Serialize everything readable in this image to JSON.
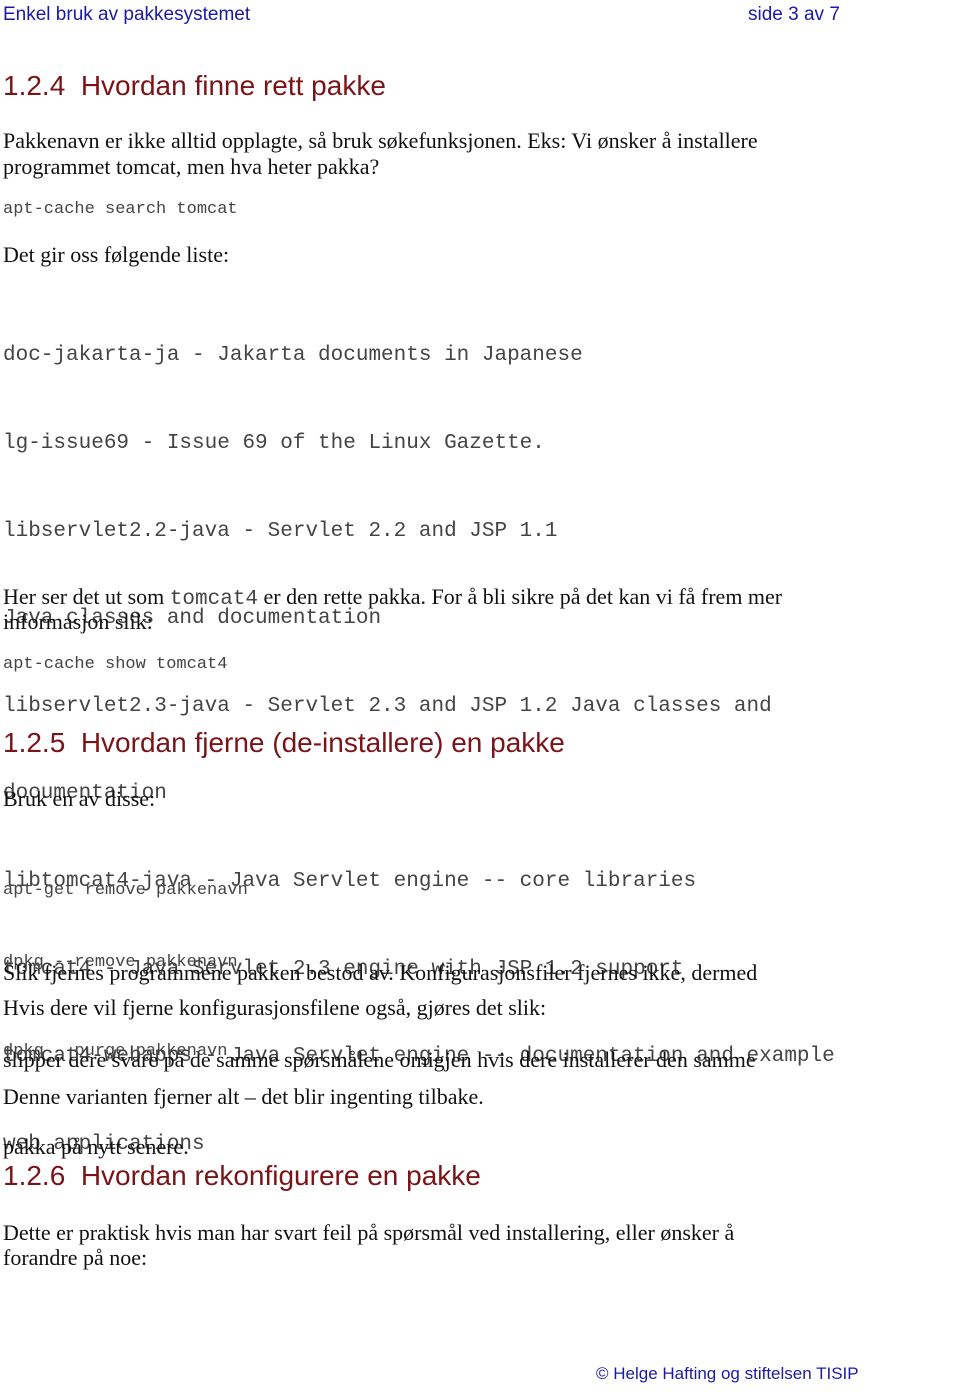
{
  "header": {
    "doc_title": "Enkel bruk av pakkesystemet",
    "page_indicator": "side 3 av 7"
  },
  "sections": [
    {
      "heading": "1.2.4  Hvordan finne rett pakke",
      "intro_line1": "Pakkenavn er ikke alltid opplagte, så bruk søkefunksjonen. Eks: Vi ønsker å installere",
      "intro_line2": "programmet tomcat, men hva heter pakka?",
      "command": "apt-cache search tomcat",
      "list_intro": "Det gir oss følgende liste:",
      "output_lines": [
        "doc-jakarta-ja - Jakarta documents in Japanese",
        "lg-issue69 - Issue 69 of the Linux Gazette.",
        "libservlet2.2-java - Servlet 2.2 and JSP 1.1",
        "Java classes and documentation",
        "libservlet2.3-java - Servlet 2.3 and JSP 1.2 Java classes and",
        "documentation",
        "libtomcat4-java - Java Servlet engine -- core libraries",
        "tomcat4 - Java Servlet 2.3 engine with JSP 1.2 support",
        "tomcat4-webapps - Java Servlet engine -- documentation and example",
        "web applications"
      ],
      "conclusion_pre": "Her ser det ut som ",
      "conclusion_code": "tomcat4",
      "conclusion_post": " er den rette pakka. For å bli sikre på det kan vi få frem mer",
      "conclusion_line2": "informasjon slik:",
      "command2": "apt-cache show tomcat4"
    },
    {
      "heading": "1.2.5  Hvordan fjerne (de-installere) en pakke",
      "intro": "Bruk en av disse:",
      "commands": [
        "apt-get remove pakkenavn",
        "dpkg --remove pakkenavn"
      ],
      "para_lines": [
        "Slik fjernes programmene pakken bestod av. Konfigurasjonsfiler fjernes ikke, dermed",
        "slipper dere svare på de samme spørsmålene omigjen hvis dere installerer den samme",
        "pakka på nytt senere."
      ],
      "purge_intro": "Hvis dere vil fjerne konfigurasjonsfilene også, gjøres det slik:",
      "purge_command": "dpkg --purge pakkenavn",
      "purge_note": "Denne varianten fjerner alt – det blir ingenting tilbake."
    },
    {
      "heading": "1.2.6  Hvordan rekonfigurere en pakke",
      "intro_line1": "Dette er praktisk hvis man har svart feil på spørsmål ved installering, eller ønsker å",
      "intro_line2": "forandre på noe:"
    }
  ],
  "footer": {
    "copyright": "© Helge Hafting og stiftelsen TISIP"
  }
}
